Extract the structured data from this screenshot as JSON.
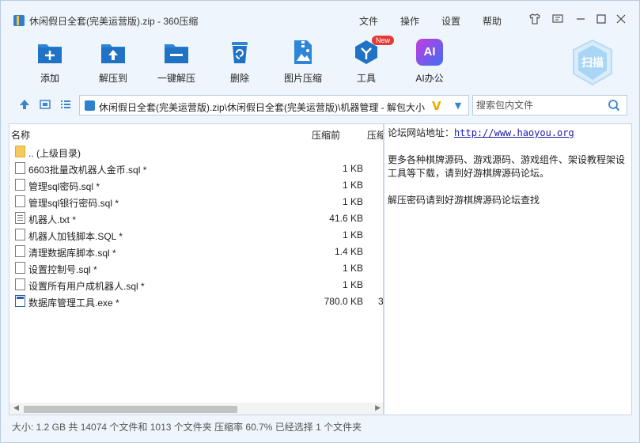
{
  "window": {
    "title": "休闲假日全套(完美运营版).zip - 360压缩",
    "menu": [
      "文件",
      "操作",
      "设置",
      "帮助"
    ]
  },
  "toolbar": {
    "items": [
      {
        "label": "添加",
        "icon": "add-icon"
      },
      {
        "label": "解压到",
        "icon": "extract-to-icon"
      },
      {
        "label": "一键解压",
        "icon": "one-click-extract-icon"
      },
      {
        "label": "删除",
        "icon": "delete-icon"
      },
      {
        "label": "图片压缩",
        "icon": "image-compress-icon"
      },
      {
        "label": "工具",
        "icon": "tools-icon",
        "badge": "New"
      },
      {
        "label": "AI办公",
        "icon": "ai-office-icon",
        "glyph": "AI"
      }
    ],
    "scan_label": "扫描"
  },
  "address": {
    "path": "休闲假日全套(完美运营版).zip\\休闲假日全套(完美运营版)\\机器管理 - 解包大小",
    "search_placeholder": "搜索包内文件"
  },
  "file_list": {
    "columns": {
      "name": "名称",
      "size": "压缩前",
      "extra": "压缩"
    },
    "rows": [
      {
        "name": ".. (上级目录)",
        "size": "",
        "type": "folder"
      },
      {
        "name": "6603批量改机器人金币.sql *",
        "size": "1 KB",
        "type": "doc"
      },
      {
        "name": "管理sql密码.sql *",
        "size": "1 KB",
        "type": "doc"
      },
      {
        "name": "管理sql银行密码.sql *",
        "size": "1 KB",
        "type": "doc"
      },
      {
        "name": "机器人.txt *",
        "size": "41.6 KB",
        "type": "txt"
      },
      {
        "name": "机器人加钱脚本.SQL *",
        "size": "1 KB",
        "type": "doc"
      },
      {
        "name": "清理数据库脚本.sql *",
        "size": "1.4 KB",
        "type": "doc"
      },
      {
        "name": "设置控制号.sql *",
        "size": "1 KB",
        "type": "doc"
      },
      {
        "name": "设置所有用户成机器人.sql *",
        "size": "1 KB",
        "type": "doc"
      },
      {
        "name": "数据库管理工具.exe *",
        "size": "780.0 KB",
        "type": "exe",
        "extra": "3"
      }
    ]
  },
  "comment": {
    "site_label": "论坛网站地址：",
    "site_url": "http://www.haoyou.org",
    "line2": "更多各种棋牌源码、游戏源码、游戏组件、架设教程架设工具等下载，请到好游棋牌源码论坛。",
    "line3": "解压密码请到好游棋牌源码论坛查找"
  },
  "status": {
    "text": "大小: 1.2 GB 共 14074 个文件和 1013 个文件夹 压缩率 60.7% 已经选择 1 个文件夹"
  },
  "colors": {
    "accent": "#2f7fd0",
    "window_bg": "#eef5fc",
    "badge": "#e53935"
  }
}
